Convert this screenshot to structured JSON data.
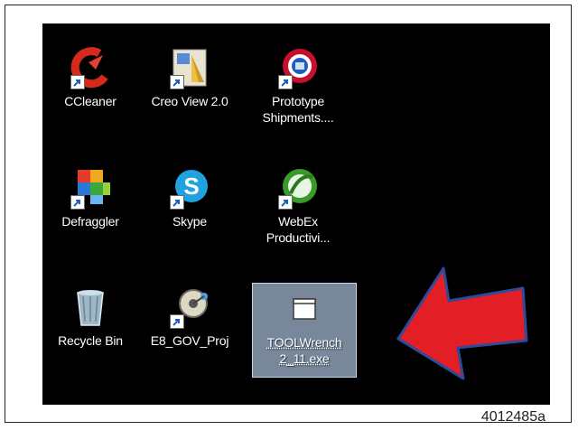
{
  "desktop": {
    "icons": [
      {
        "label_lines": [
          "CCleaner"
        ],
        "icon": "ccleaner-icon"
      },
      {
        "label_lines": [
          "Creo View 2.0"
        ],
        "icon": "creo-view-icon"
      },
      {
        "label_lines": [
          "Prototype",
          "Shipments...."
        ],
        "icon": "prototype-shipments-icon"
      },
      {
        "label_lines": [
          "Defraggler"
        ],
        "icon": "defraggler-icon"
      },
      {
        "label_lines": [
          "Skype"
        ],
        "icon": "skype-icon"
      },
      {
        "label_lines": [
          "WebEx",
          "Productivi..."
        ],
        "icon": "webex-productivity-icon"
      },
      {
        "label_lines": [
          "Recycle Bin"
        ],
        "icon": "recycle-bin-icon"
      },
      {
        "label_lines": [
          "E8_GOV_Proj"
        ],
        "icon": "e8-gov-proj-icon"
      },
      {
        "label_lines": [
          "TOOLWrench",
          "2_11.exe"
        ],
        "icon": "exe-file-icon",
        "selected": true
      }
    ]
  },
  "annotation": {
    "arrow": "red-arrow-icon",
    "arrow_color": "#e31e24"
  },
  "figure_id": "4012485a",
  "colors": {
    "desktop_bg": "#000000",
    "selection": "#a0b4cd"
  }
}
